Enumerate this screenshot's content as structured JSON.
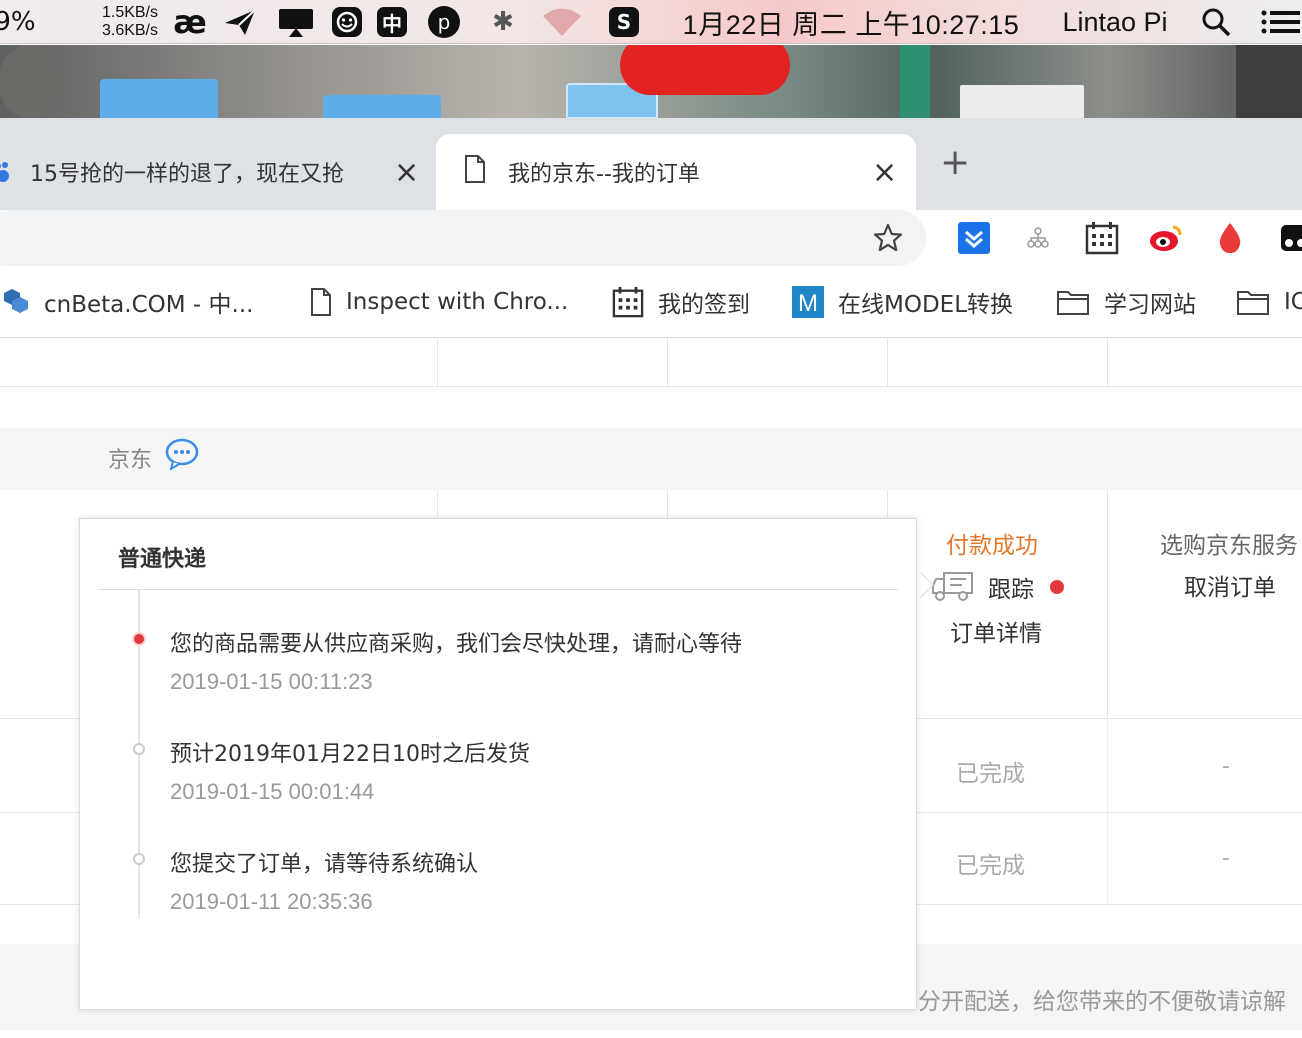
{
  "menubar": {
    "battery": "9%",
    "net_up": "1.5KB/s",
    "net_down": "3.6KB/s",
    "clock": "1月22日 周二 上午10:27:15",
    "user": "Lintao Pi",
    "tray": {
      "zh_char": "中",
      "p_char": "p",
      "s_char": "S",
      "ae_char": "æ"
    }
  },
  "tabs": [
    {
      "title": "15号抢的一样的退了，现在又抢",
      "active": false
    },
    {
      "title": "我的京东--我的订单",
      "active": true
    }
  ],
  "bookmarks": [
    {
      "label": "cnBeta.COM - 中...",
      "icon": "cnbeta-icon"
    },
    {
      "label": "Inspect with Chro...",
      "icon": "page-icon"
    },
    {
      "label": "我的签到",
      "icon": "calendar-icon"
    },
    {
      "label": "在线MODEL转换",
      "icon": "m-icon"
    },
    {
      "label": "学习网站",
      "icon": "folder-icon"
    },
    {
      "label": "IC",
      "icon": "folder-icon"
    }
  ],
  "order": {
    "shop": "京东",
    "status": "付款成功",
    "track_label": "跟踪",
    "detail_label": "订单详情",
    "service_label": "选购京东服务",
    "cancel_label": "取消订单",
    "rows": [
      {
        "status": "已完成",
        "action": "-"
      },
      {
        "status": "已完成",
        "action": "-"
      }
    ],
    "notice": "分开配送，给您带来的不便敬请谅解"
  },
  "popup": {
    "title": "普通快递",
    "events": [
      {
        "text": "您的商品需要从供应商采购，我们会尽快处理，请耐心等待",
        "time": "2019-01-15 00:11:23",
        "current": true
      },
      {
        "text": "预计2019年01月22日10时之后发货",
        "time": "2019-01-15 00:01:44",
        "current": false
      },
      {
        "text": "您提交了订单，请等待系统确认",
        "time": "2019-01-11 20:35:36",
        "current": false
      }
    ]
  },
  "colors": {
    "accent_red": "#e4393c",
    "status_orange": "#e4792a",
    "muted_text": "#999999"
  }
}
